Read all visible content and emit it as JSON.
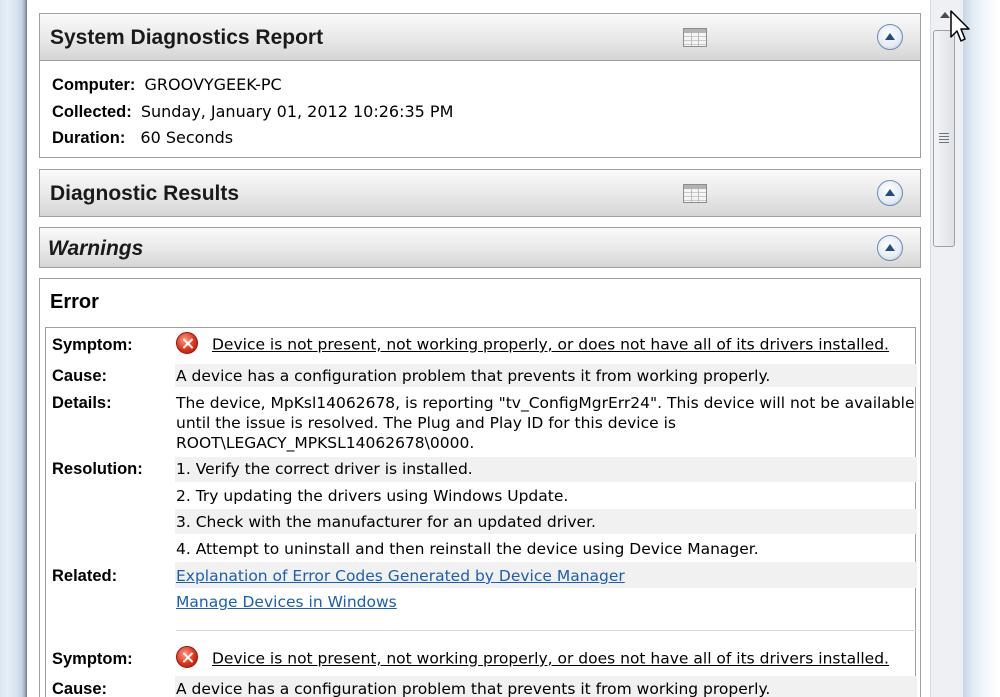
{
  "report": {
    "title": "System Diagnostics Report",
    "computer_label": "Computer:",
    "computer_value": "GROOVYGEEK-PC",
    "collected_label": "Collected:",
    "collected_value": "Sunday, January 01, 2012 10:26:35 PM",
    "duration_label": "Duration:",
    "duration_value": "60 Seconds"
  },
  "diagnostic_results": {
    "title": "Diagnostic Results"
  },
  "warnings": {
    "title": "Warnings"
  },
  "error": {
    "title": "Error",
    "entries": [
      {
        "symptom_label": "Symptom:",
        "symptom": "Device is not present, not working properly, or does not have all of its drivers installed.",
        "cause_label": "Cause:",
        "cause": "A device has a configuration problem that prevents it from working properly.",
        "details_label": "Details:",
        "details": "The device, MpKsl14062678, is reporting \"tv_ConfigMgrErr24\". This device will not be available until the issue is resolved. The Plug and Play ID for this device is ROOT\\LEGACY_MPKSL14062678\\0000.",
        "resolution_label": "Resolution:",
        "resolution": [
          "1. Verify the correct driver is installed.",
          "2. Try updating the drivers using Windows Update.",
          "3. Check with the manufacturer for an updated driver.",
          "4. Attempt to uninstall and then reinstall the device using Device Manager."
        ],
        "related_label": "Related:",
        "related": [
          "Explanation of Error Codes Generated by Device Manager",
          "Manage Devices in Windows"
        ]
      },
      {
        "symptom_label": "Symptom:",
        "symptom": "Device is not present, not working properly, or does not have all of its drivers installed.",
        "cause_label": "Cause:",
        "cause": "A device has a configuration problem that prevents it from working properly."
      }
    ]
  },
  "icons": {
    "table_view": "table-icon",
    "collapse": "collapse-up-icon",
    "error": "error-icon",
    "cursor": "mouse-pointer-icon"
  },
  "colors": {
    "link": "#1a5fb4",
    "error_icon": "#e0311a",
    "header_gradient_top": "#fafafa",
    "header_gradient_bottom": "#d5d5d5"
  }
}
